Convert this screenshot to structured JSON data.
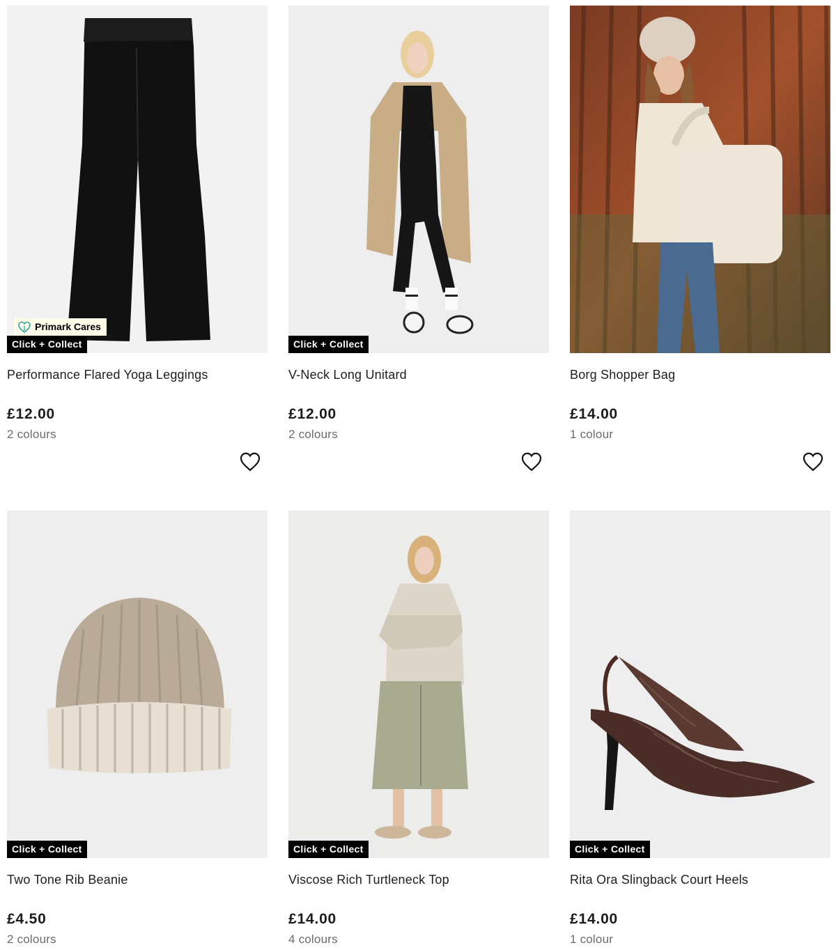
{
  "colors": {
    "badge_bg": "#000000",
    "badge_text": "#ffffff",
    "cares_bg": "#fffbe9",
    "cares_icon": "#2fa6a0",
    "price": "#1b1b1b",
    "muted": "#6b6b6b"
  },
  "products": [
    {
      "name": "Performance Flared Yoga Leggings",
      "price": "£12.00",
      "colours": "2 colours",
      "badge": "Click + Collect",
      "cares_badge": "Primark Cares",
      "image": "black-flared-leggings"
    },
    {
      "name": "V-Neck Long Unitard",
      "price": "£12.00",
      "colours": "2 colours",
      "badge": "Click + Collect",
      "image": "model-black-unitard-trench"
    },
    {
      "name": "Borg Shopper Bag",
      "price": "£14.00",
      "colours": "1 colour",
      "image": "model-borg-bag-rust-wall"
    },
    {
      "name": "Two Tone Rib Beanie",
      "price": "£4.50",
      "colours": "2 colours",
      "badge": "Click + Collect",
      "image": "beige-rib-beanie"
    },
    {
      "name": "Viscose Rich Turtleneck Top",
      "price": "£14.00",
      "colours": "4 colours",
      "badge": "Click + Collect",
      "image": "model-turtleneck-skirt"
    },
    {
      "name": "Rita Ora Slingback Court Heels",
      "price": "£14.00",
      "colours": "1 colour",
      "badge": "Click + Collect",
      "image": "snakeskin-slingback-heel"
    }
  ],
  "icons": {
    "wishlist": "heart-outline-icon",
    "cares": "heart-leaf-icon"
  }
}
